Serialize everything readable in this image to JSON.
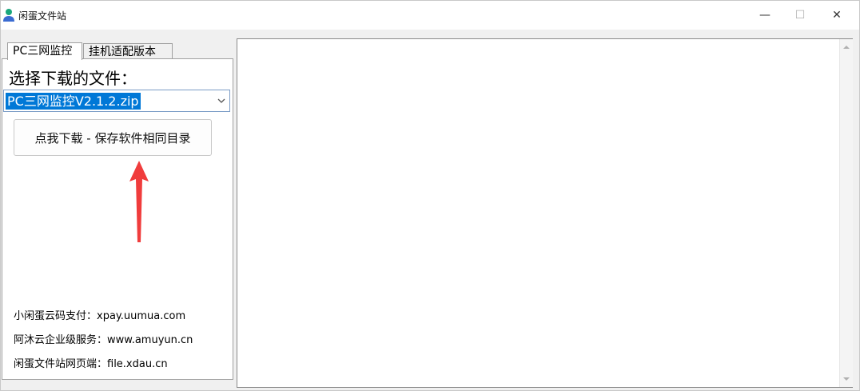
{
  "window": {
    "title": "闲蛋文件站",
    "controls": {
      "minimize": "—",
      "maximize": "☐",
      "close": "✕"
    }
  },
  "tabs": [
    {
      "label": "PC三网监控",
      "active": true
    },
    {
      "label": "挂机适配版本",
      "active": false
    }
  ],
  "panel": {
    "choose_label": "选择下载的文件：",
    "file_select": {
      "value": "PC三网监控V2.1.2.zip"
    },
    "download_button": "点我下载 - 保存软件相同目录",
    "info_lines": [
      "小闲蛋云码支付：xpay.uumua.com",
      "阿沐云企业级服务：www.amuyun.cn",
      "闲蛋文件站网页端：file.xdau.cn"
    ]
  },
  "output": {
    "text": ""
  },
  "colors": {
    "selection": "#0078d7",
    "arrow": "#f03c3c",
    "accent_icon": "#19a77c"
  }
}
